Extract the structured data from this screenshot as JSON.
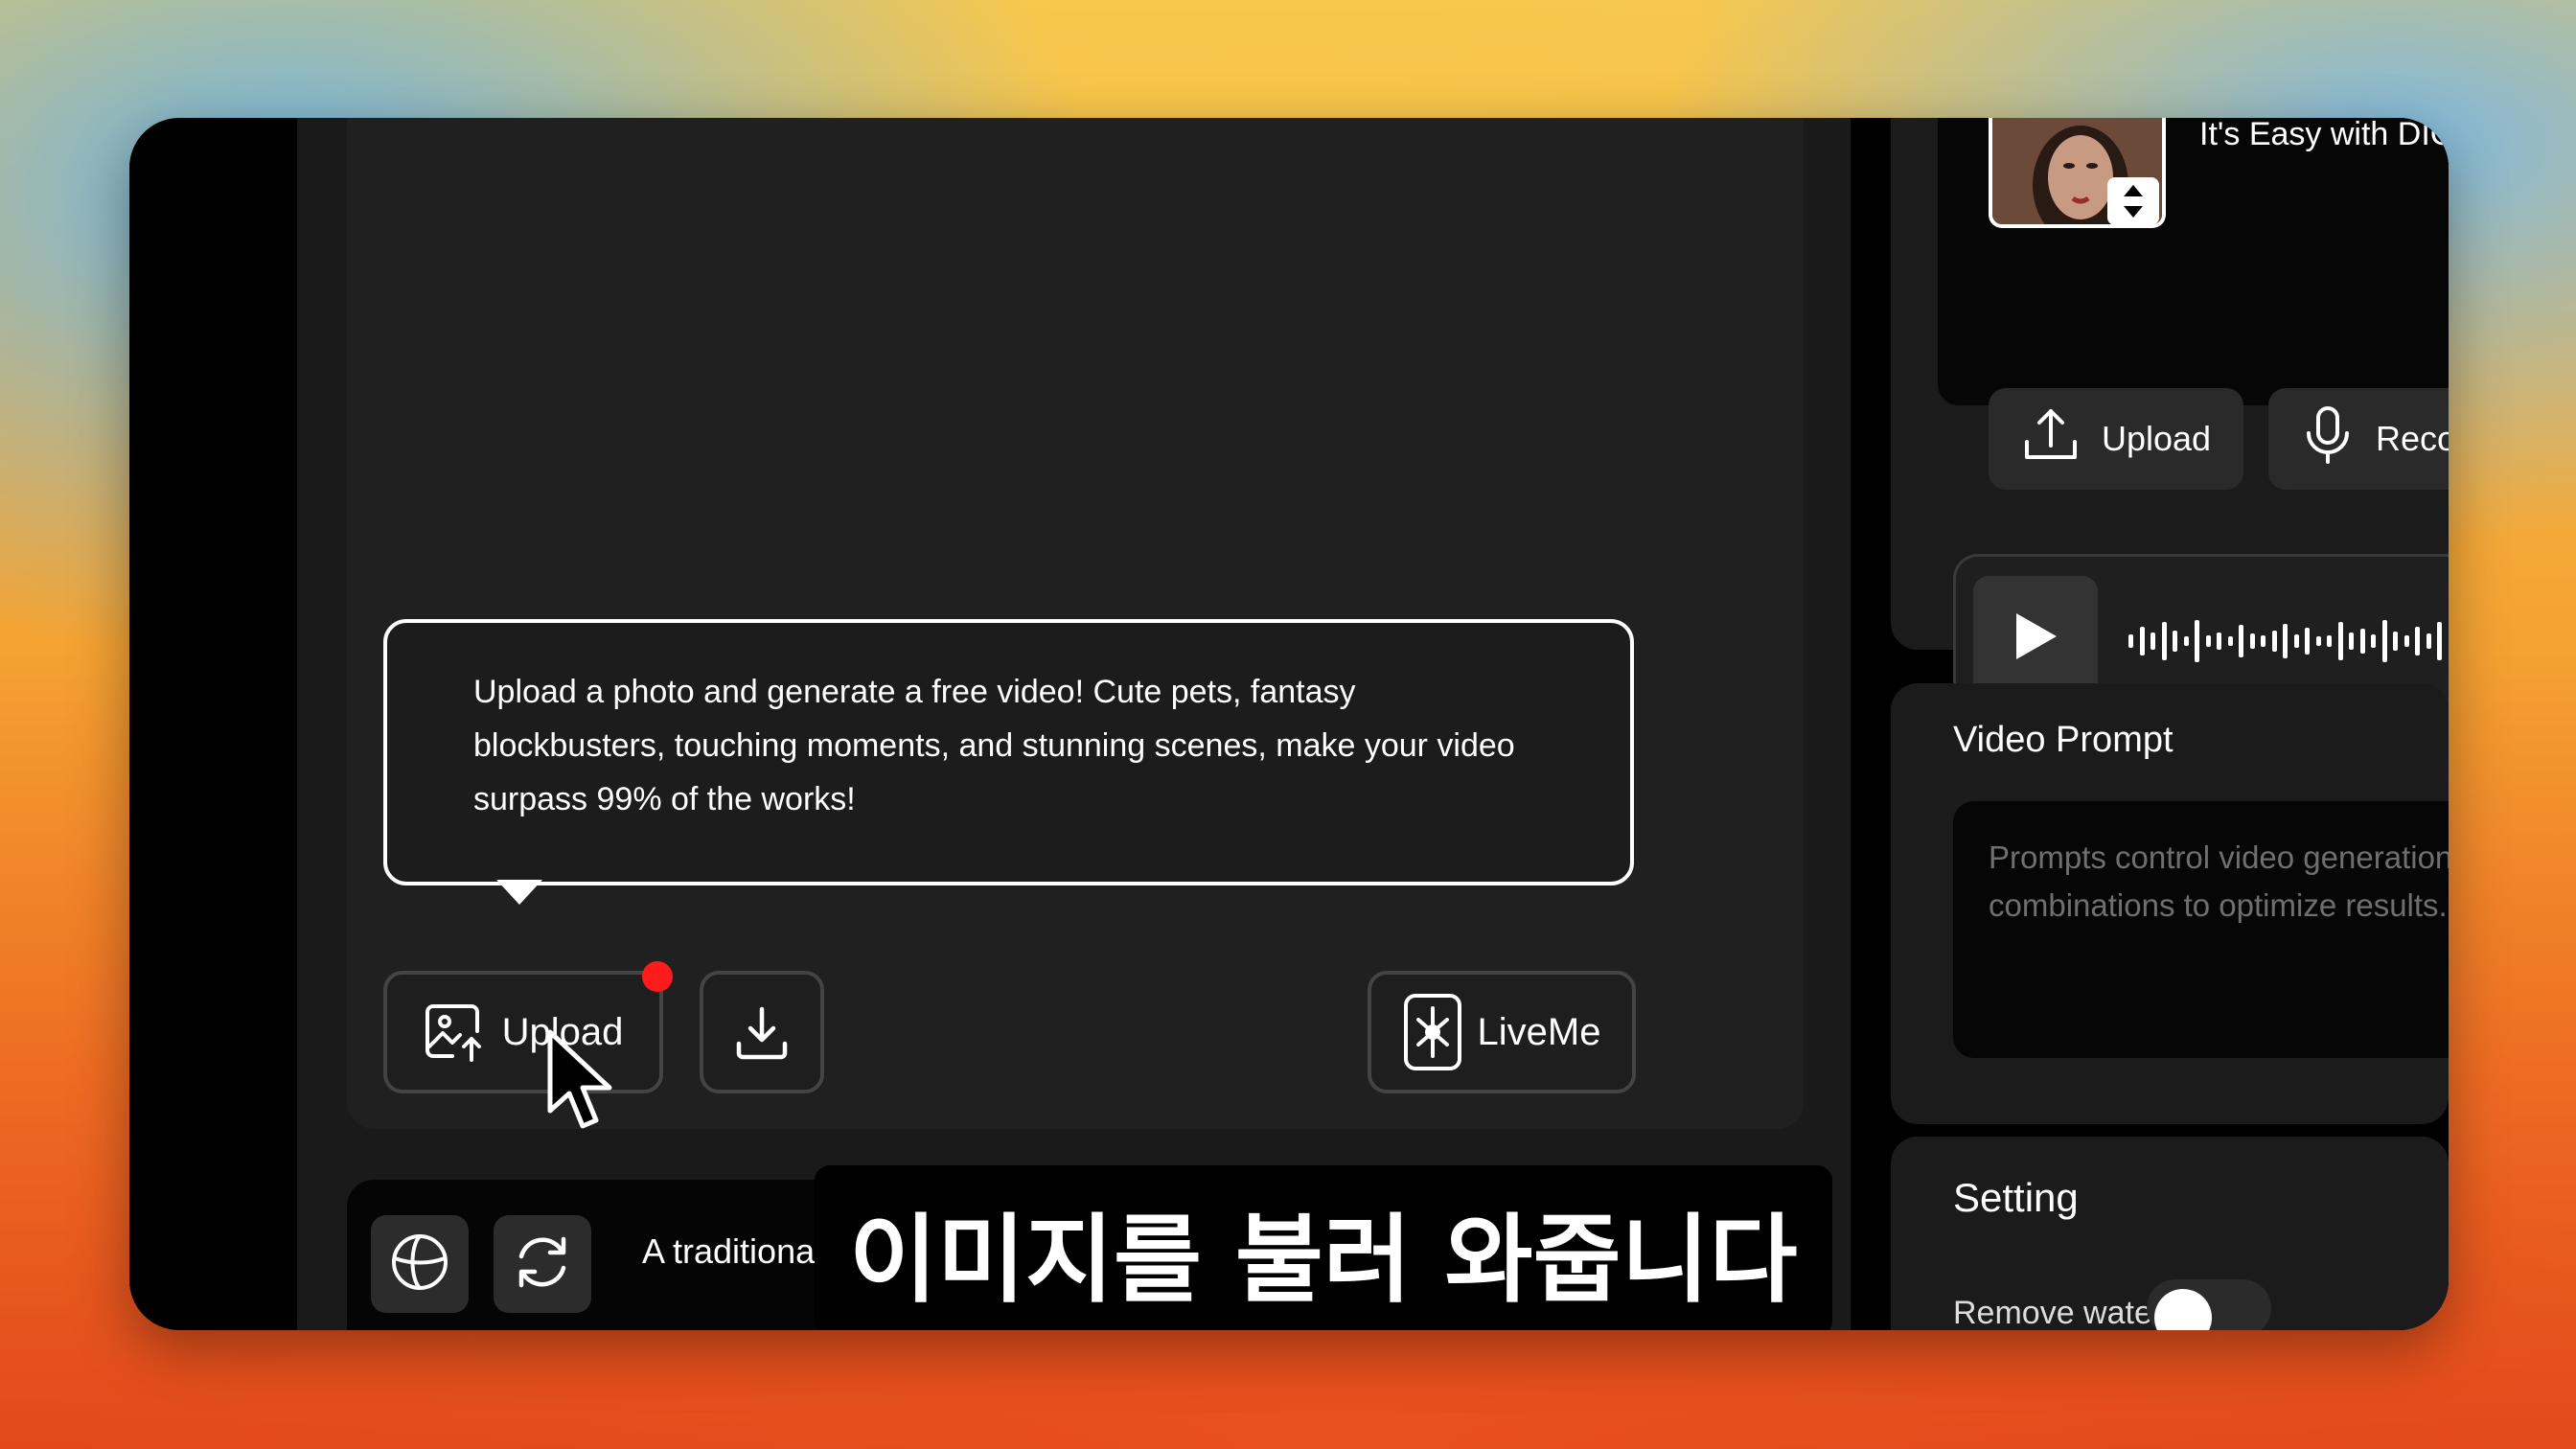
{
  "tooltip": {
    "text": "Upload a photo and generate a free video! Cute pets, fantasy blockbusters, touching moments, and stunning scenes, make your video surpass 99% of the works!"
  },
  "toolbar": {
    "upload_label": "Upload",
    "liveme_label": "LiveMe"
  },
  "prompt_bar": {
    "text": "A traditiona"
  },
  "subtitle": "이미지를 불러 와줍니다",
  "right": {
    "header_text": "It's Easy with DIGEN's Re",
    "audio_upload_label": "Upload",
    "recording_label": "Recording",
    "video_prompt_title": "Video Prompt",
    "video_prompt_placeholder_1": "Prompts control video generation. Ente",
    "video_prompt_placeholder_2": "combinations to optimize results.",
    "setting_title": "Setting",
    "remove_watermark_label": "Remove watermark"
  },
  "colors": {
    "notification_dot": "#ff1b1b",
    "panel": "#1b1b1b"
  }
}
